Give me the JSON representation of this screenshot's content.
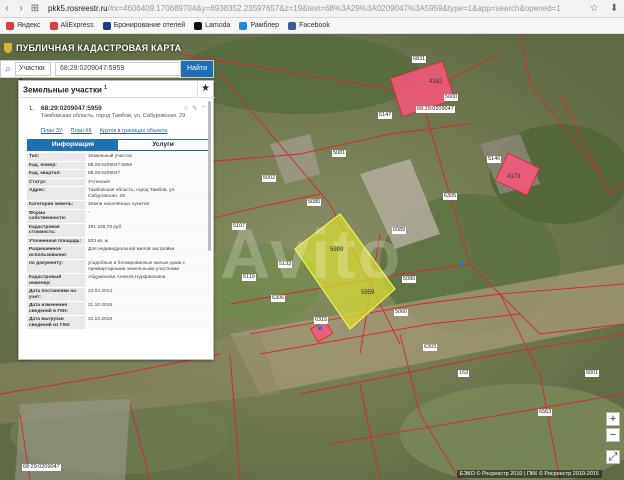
{
  "browser": {
    "url_host": "pkk5.rosreestr.ru",
    "url_rest": "/#x=4606409.170689704&y=6938352.23597657&z=19&text=68%3A29%3A0209047%3A5959&type=1&app=search&opened=1",
    "bookmarks": [
      {
        "label": "Яндекс",
        "color": "#e53935"
      },
      {
        "label": "AliExpress",
        "color": "#e53935"
      },
      {
        "label": "Бронирование отелей",
        "color": "#1e3a8a"
      },
      {
        "label": "Lamoda",
        "color": "#111111"
      },
      {
        "label": "Рамблер",
        "color": "#1e88e5"
      },
      {
        "label": "Facebook",
        "color": "#3b5998"
      }
    ]
  },
  "header": {
    "title": "ПУБЛИЧНАЯ КАДАСТРОВАЯ КАРТА"
  },
  "search": {
    "type_label": "Участки",
    "query": "68:29:0209047:5959",
    "button": "Найти"
  },
  "panel": {
    "title": "Земельные участки",
    "count": "1",
    "entry": {
      "num": "1.",
      "id": "68:29:0209047:5959",
      "address": "Тамбовская область, город Тамбов, ул. Сабуровская, 29",
      "links": [
        "План ЗУ",
        "План КК",
        "Кругок в границах объекта"
      ]
    },
    "tabs": [
      "Информация",
      "Услуги"
    ],
    "rows": [
      {
        "k": "Тип:",
        "v": "Земельный участок"
      },
      {
        "k": "Кад. номер:",
        "v": "68:29:0209047:5959"
      },
      {
        "k": "Кад. квартал:",
        "v": "68:29:0209047"
      },
      {
        "k": "Статус:",
        "v": "Учтенный"
      },
      {
        "k": "Адрес:",
        "v": "Тамбовская область, город Тамбов, ул. Сабуровская, 29"
      },
      {
        "k": "Категория земель:",
        "v": "Земли населённых пунктов"
      },
      {
        "k": "Форма собственности:",
        "v": "-"
      },
      {
        "k": "Кадастровая стоимость:",
        "v": "291 226,78 руб"
      },
      {
        "k": "Уточненная площадь:",
        "v": "833 кв. м"
      },
      {
        "k": "Разрешенное использование:",
        "v": "Для индивидуальной жилой застройки"
      },
      {
        "k": "по документу:",
        "v": "усадебные и блокированные жилые дома с приквартирными земельными участками"
      },
      {
        "k": "Кадастровый инженер:",
        "v": "Абдуманова Анжела Нурфаизовна"
      },
      {
        "k": "Дата постановки на учет:",
        "v": "24.04.2014"
      },
      {
        "k": "Дата изменения сведений в ГКН:",
        "v": "31.10.2018"
      },
      {
        "k": "Дата выгрузки сведений из ГКН:",
        "v": "31.10.2018"
      }
    ]
  },
  "map": {
    "labels": [
      "6831",
      "4182",
      "5146",
      "5147",
      "5081",
      "5000",
      "5002",
      "5107",
      "5085",
      "6305",
      "5089",
      "5119",
      "5133",
      "6315",
      "5060",
      "5999",
      "5959",
      "5080",
      "4173",
      "6306",
      "6303",
      "163",
      "6563",
      "6001",
      "68:29:0209047",
      "68:29:0209047"
    ],
    "copyright": "ЕЭКО © Росреестр 2010 | ПКК © Росреестр 2010-2015"
  }
}
